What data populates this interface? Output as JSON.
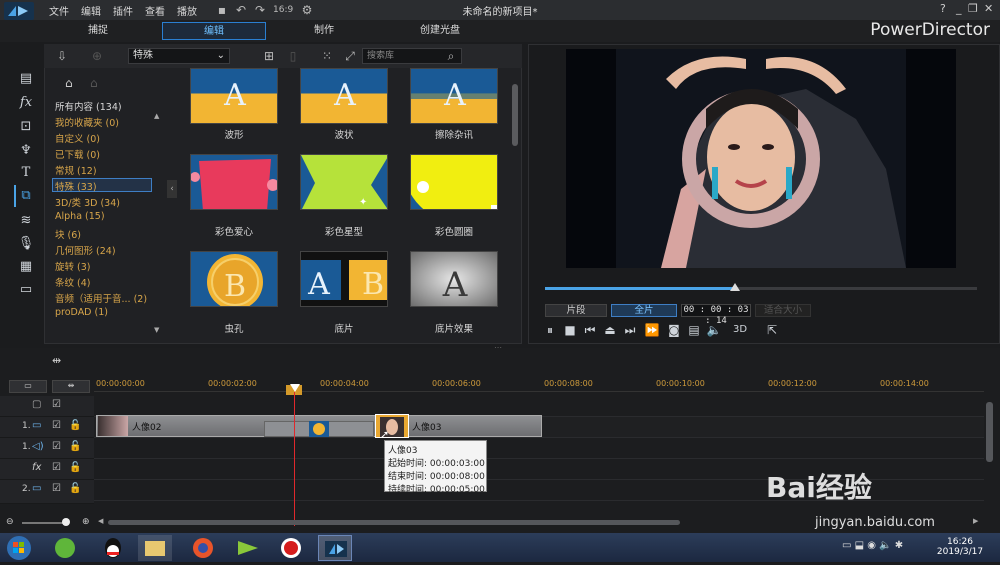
{
  "app": {
    "title": "未命名的新项目*",
    "brand": "PowerDirector",
    "menu": [
      "文件",
      "编辑",
      "插件",
      "查看",
      "播放"
    ],
    "modes": [
      "捕捉",
      "编辑",
      "制作",
      "创建光盘"
    ],
    "active_mode": "编辑"
  },
  "library": {
    "category_select": "特殊",
    "search_placeholder": "搜索库",
    "categories": [
      {
        "label": "所有内容 (134)"
      },
      {
        "label": "我的收藏夹 (0)"
      },
      {
        "label": "自定义 (0)"
      },
      {
        "label": "已下载 (0)"
      },
      {
        "label": "常规 (12)"
      },
      {
        "label": "特殊 (33)"
      },
      {
        "label": "3D/类 3D (34)"
      },
      {
        "label": "Alpha (15)"
      },
      {
        "label": "块 (6)"
      },
      {
        "label": "几何图形 (24)"
      },
      {
        "label": "旋转 (3)"
      },
      {
        "label": "条纹 (4)"
      },
      {
        "label": "音频（适用于音... (2)"
      },
      {
        "label": "proDAD (1)"
      }
    ],
    "selected_category": "特殊 (33)",
    "transitions": [
      {
        "label": "波形",
        "letter": "A"
      },
      {
        "label": "波状",
        "letter": "A"
      },
      {
        "label": "擦除杂讯",
        "letter": "A"
      },
      {
        "label": "彩色爱心",
        "letter": ""
      },
      {
        "label": "彩色星型",
        "letter": ""
      },
      {
        "label": "彩色圆圈",
        "letter": ""
      },
      {
        "label": "虫孔",
        "letter": "B"
      },
      {
        "label": "底片",
        "letter": "A"
      },
      {
        "label": "底片效果",
        "letter": "A"
      }
    ]
  },
  "preview": {
    "btn_segment": "片段",
    "btn_full": "全片",
    "timecode": "00 : 00 : 03 : 14",
    "fit": "适合大小",
    "mode3d": "3D",
    "progress": 0.44
  },
  "timeline": {
    "ruler": [
      "00:00:00:00",
      "00:00:02:00",
      "00:00:04:00",
      "00:00:06:00",
      "00:00:08:00",
      "00:00:10:00",
      "00:00:12:00",
      "00:00:14:00"
    ],
    "track_labels": [
      "1.",
      "1.",
      "fx",
      "2."
    ],
    "clips": [
      {
        "label": "人像02"
      },
      {
        "label": "人像03"
      }
    ],
    "tooltip": {
      "title": "人像03",
      "start": "起始时间: 00:00:03:00",
      "end": "结束时间: 00:00:08:00",
      "duration": "持续时间: 00:00:05:00"
    }
  },
  "taskbar": {
    "time": "16:26",
    "date": "2019/3/17"
  },
  "watermark": {
    "text": "Bai经验",
    "url": "jingyan.baidu.com"
  }
}
